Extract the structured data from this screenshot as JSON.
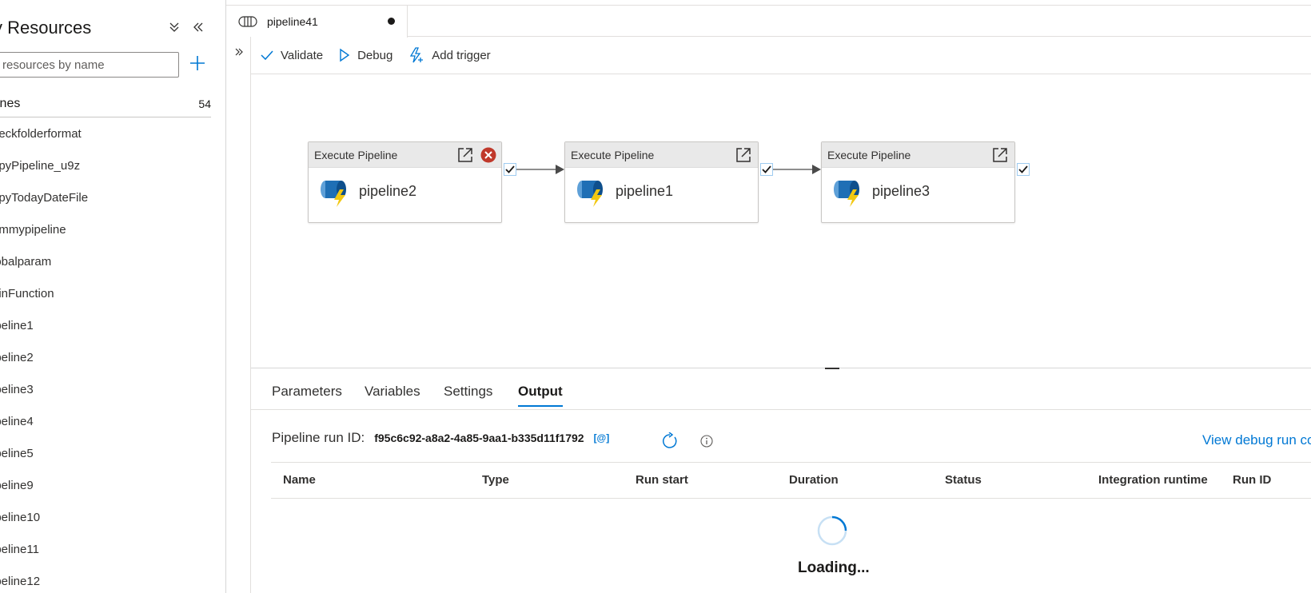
{
  "left_panel": {
    "title": "y Resources",
    "search_placeholder": "resources by name",
    "pipelines_label": "ines",
    "pipelines_count": "54",
    "items": [
      "heckfolderformat",
      "opyPipeline_u9z",
      "opyTodayDateFile",
      "ummypipeline",
      "lobalparam",
      "oinFunction",
      "ipeline1",
      "ipeline2",
      "ipeline3",
      "ipeline4",
      "ipeline5",
      "ipeline9",
      "ipeline10",
      "ipeline11",
      "ipeline12"
    ]
  },
  "tab": {
    "label": "pipeline41"
  },
  "toolbar": {
    "validate": "Validate",
    "debug": "Debug",
    "add_trigger": "Add trigger"
  },
  "activities": [
    {
      "type": "Execute Pipeline",
      "name": "pipeline2",
      "has_delete": true
    },
    {
      "type": "Execute Pipeline",
      "name": "pipeline1",
      "has_delete": false
    },
    {
      "type": "Execute Pipeline",
      "name": "pipeline3",
      "has_delete": false
    }
  ],
  "bottom": {
    "tabs": [
      "Parameters",
      "Variables",
      "Settings",
      "Output"
    ],
    "active_tab": "Output",
    "run_id_label": "Pipeline run ID:",
    "run_id_value": "f95c6c92-a8a2-4a85-9aa1-b335d11f1792",
    "copy_label": "[@]",
    "view_debug": "View debug run co",
    "columns": [
      "Name",
      "Type",
      "Run start",
      "Duration",
      "Status",
      "Integration runtime",
      "Run ID"
    ],
    "loading_text": "Loading..."
  },
  "colors": {
    "accent": "#0078d4",
    "error": "#c0392b",
    "pipeline_icon_blue": "#1f6fb5",
    "pipeline_icon_bolt": "#f2c811"
  }
}
